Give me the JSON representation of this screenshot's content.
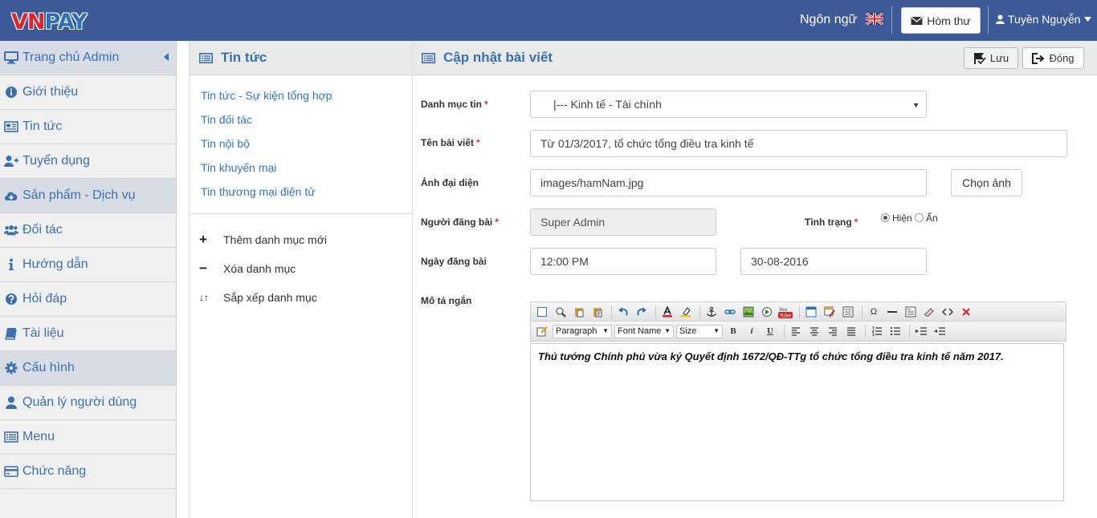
{
  "header": {
    "logo_vn": "VN",
    "logo_pay": "PAY",
    "language_label": "Ngôn ngữ",
    "language_flag_icon": "uk-flag-icon",
    "mail_button_label": "Hòm thư",
    "user_name": "Tuyền Nguyễn"
  },
  "sidebar": {
    "items": [
      {
        "label": "Trang chủ Admin",
        "icon": "monitor-icon"
      },
      {
        "label": "Giới thiệu",
        "icon": "info-icon"
      },
      {
        "label": "Tin tức",
        "icon": "newspaper-icon"
      },
      {
        "label": "Tuyển dụng",
        "icon": "user-plus-icon"
      },
      {
        "label": "Sản phẩm - Dịch vụ",
        "icon": "cloud-download-icon"
      },
      {
        "label": "Đối tác",
        "icon": "users-icon"
      },
      {
        "label": "Hướng dẫn",
        "icon": "info-icon"
      },
      {
        "label": "Hỏi đáp",
        "icon": "question-icon"
      },
      {
        "label": "Tài liệu",
        "icon": "book-icon"
      },
      {
        "label": "Cấu hình",
        "icon": "gear-icon"
      },
      {
        "label": "Quản lý người dùng",
        "icon": "user-icon"
      },
      {
        "label": "Menu",
        "icon": "list-icon"
      },
      {
        "label": "Chức năng",
        "icon": "card-icon"
      }
    ]
  },
  "categories": {
    "title": "Tin tức",
    "items": [
      "Tin tức - Sự kiện tổng hợp",
      "Tin đối tác",
      "Tin nội bộ",
      "Tin khuyến mại",
      "Tin thương mại điện tử"
    ],
    "actions": [
      {
        "symbol": "+",
        "label": "Thêm danh mục mới"
      },
      {
        "symbol": "−",
        "label": "Xóa danh mục"
      },
      {
        "symbol": "↓↑",
        "label": "Sắp xếp danh mục"
      }
    ]
  },
  "form": {
    "title": "Cập nhật bài viết",
    "save_label": "Lưu",
    "close_label": "Đóng",
    "category_label": "Danh mục tin",
    "category_value": "|--- Kinh tế - Tài chính",
    "title_label": "Tên bài viết",
    "title_value": "Từ 01/3/2017, tổ chức tổng điều tra kinh tế",
    "image_label": "Ảnh đại diện",
    "image_value": "images/hamNam.jpg",
    "choose_image_label": "Chọn ảnh",
    "author_label": "Người đăng bài",
    "author_value": "Super Admin",
    "status_label": "Tình trạng",
    "status_show": "Hiện",
    "status_hide": "Ẩn",
    "date_label": "Ngày đăng bài",
    "time_value": "12:00 PM",
    "date_value": "30-08-2016",
    "summary_label": "Mô tả ngắn",
    "required_mark": "*",
    "editor": {
      "format_select": "Paragraph",
      "font_select": "Font Name",
      "size_select": "Size",
      "content": "Thủ tướng Chính phủ vừa ký Quyết định 1672/QĐ-TTg tổ chức tổng điều tra kinh tế năm 2017."
    }
  }
}
